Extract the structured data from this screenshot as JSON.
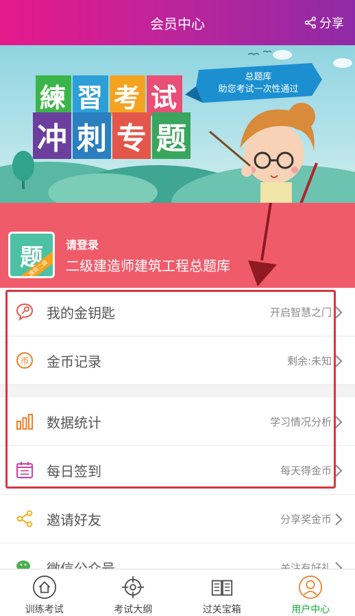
{
  "header": {
    "title": "会员中心",
    "share_label": "分享"
  },
  "banner": {
    "headline_top": [
      "練",
      "習",
      "考",
      "试"
    ],
    "headline_bottom": [
      "冲",
      "刺",
      "专",
      "题"
    ],
    "flag_line1": "总题库",
    "flag_line2": "助您考试一次性通过"
  },
  "login": {
    "prompt": "请登录",
    "bank_name": "二级建造师建筑工程总题库",
    "logo_glyph": "题",
    "logo_ribbon": "建筑二级"
  },
  "menu": [
    {
      "label": "我的金钥匙",
      "hint": "开启智慧之门",
      "icon": "key-chat-icon"
    },
    {
      "label": "金币记录",
      "hint": "剩余:未知",
      "icon": "coin-icon"
    },
    {
      "label": "数据统计",
      "hint": "学习情况分析",
      "icon": "bar-stats-icon"
    },
    {
      "label": "每日签到",
      "hint": "每天得金币",
      "icon": "calendar-icon"
    },
    {
      "label": "邀请好友",
      "hint": "分享奖金币",
      "icon": "share-icon"
    },
    {
      "label": "微信公众号",
      "hint": "关注有好礼",
      "icon": "wechat-icon"
    }
  ],
  "tabs": [
    {
      "label": "训练考试",
      "icon": "home-icon"
    },
    {
      "label": "考试大纲",
      "icon": "target-icon"
    },
    {
      "label": "过关宝箱",
      "icon": "book-icon"
    },
    {
      "label": "用户中心",
      "icon": "user-icon",
      "active": true
    }
  ],
  "colors": {
    "accent_pink": "#f05b6a",
    "active_green": "#12a83a",
    "highlight_red": "#d8363f"
  }
}
